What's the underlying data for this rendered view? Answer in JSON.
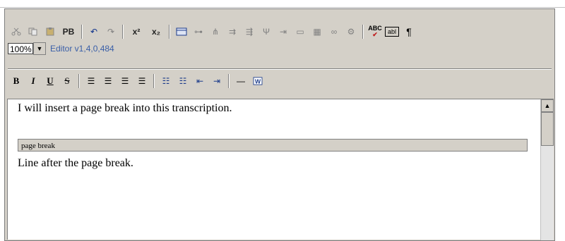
{
  "toolbar_row1": {
    "pb_label": "PB",
    "superscript_label": "x²",
    "subscript_label": "x₂",
    "abc_label": "ABC",
    "form_label": "abl",
    "pilcrow_label": "¶"
  },
  "toolbar_row2": {
    "zoom_value": "100%",
    "version": "Editor v1,4,0,484"
  },
  "toolbar_row3": {
    "bold_label": "B",
    "italic_label": "I",
    "underline_label": "U",
    "strike_label": "S"
  },
  "editor": {
    "line1": "I will insert a page break into this transcription.",
    "page_break_label": "page break",
    "line2": "Line after the page break."
  },
  "colors": {
    "toolbar_bg": "#d4d0c8",
    "version_text": "#3a5fa8"
  }
}
